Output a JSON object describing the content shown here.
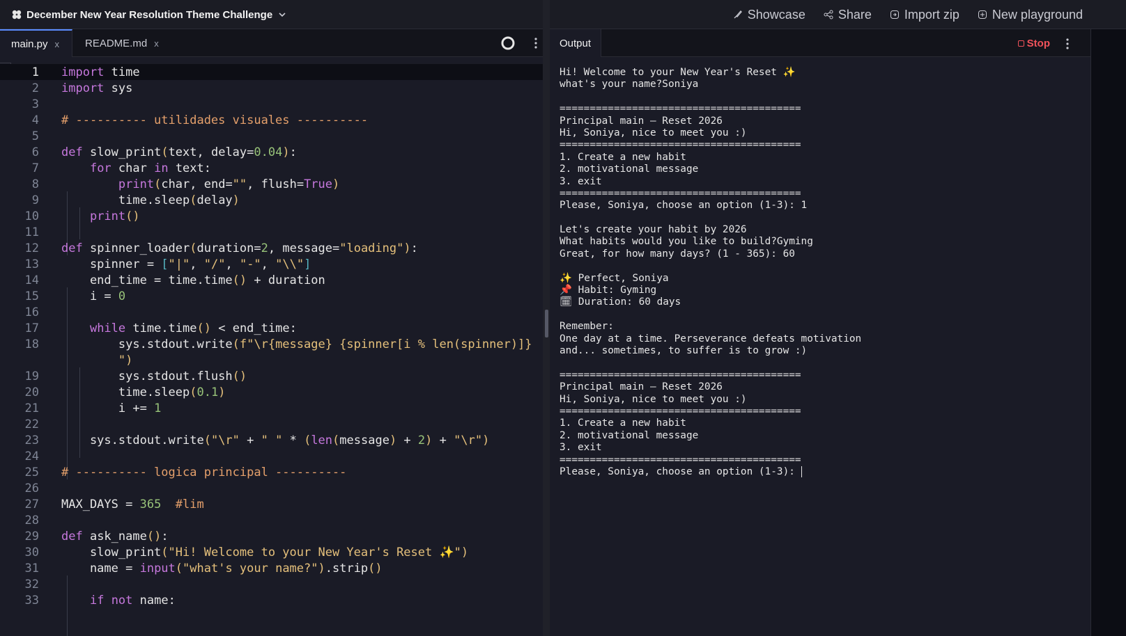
{
  "topbar": {
    "title": "December New Year Resolution Theme Challenge",
    "actions": [
      {
        "label": "Showcase",
        "icon": "brush-icon"
      },
      {
        "label": "Share",
        "icon": "share-icon"
      },
      {
        "label": "Import zip",
        "icon": "import-icon"
      },
      {
        "label": "New playground",
        "icon": "plus-circle-icon"
      }
    ]
  },
  "editor": {
    "tabs": [
      {
        "label": "main.py",
        "active": true
      },
      {
        "label": "README.md",
        "active": false
      }
    ],
    "close_glyph": "x"
  },
  "output": {
    "tab_label": "Output",
    "stop_label": "Stop",
    "lines": [
      "Hi! Welcome to your New Year's Reset ✨",
      "what's your name?Soniya",
      "",
      "========================================",
      "Principal main — Reset 2026",
      "Hi, Soniya, nice to meet you :)",
      "========================================",
      "1. Create a new habit",
      "2. motivational message",
      "3. exit",
      "========================================",
      "Please, Soniya, choose an option (1-3): 1",
      "",
      "Let's create your habit by 2026",
      "What habits would you like to build?Gyming",
      "Great, for how many days? (1 - 365): 60",
      "",
      "✨ Perfect, Soniya",
      "📌 Habit: Gyming",
      "🗓 Duration: 60 days",
      "",
      "Remember:",
      "One day at a time. Perseverance defeats motivation",
      "and... sometimes, to suffer is to grow :)",
      "",
      "========================================",
      "Principal main — Reset 2026",
      "Hi, Soniya, nice to meet you :)",
      "========================================",
      "1. Create a new habit",
      "2. motivational message",
      "3. exit",
      "========================================",
      "Please, Soniya, choose an option (1-3): "
    ]
  },
  "code": {
    "line_numbers": [
      "1",
      "2",
      "3",
      "4",
      "5",
      "6",
      "7",
      "8",
      "9",
      "10",
      "11",
      "12",
      "13",
      "14",
      "15",
      "16",
      "17",
      "18",
      "19",
      "20",
      "21",
      "22",
      "23",
      "24",
      "25",
      "26",
      "27",
      "28",
      "29",
      "30",
      "31",
      "32",
      "33"
    ],
    "lines": [
      "import time",
      "import sys",
      "",
      "# ---------- utilidades visuales ----------",
      "",
      "def slow_print(text, delay=0.04):",
      "    for char in text:",
      "        print(char, end=\"\", flush=True)",
      "        time.sleep(delay)",
      "    print()",
      "",
      "def spinner_loader(duration=2, message=\"loading\"):",
      "    spinner = [\"|\", \"/\", \"-\", \"\\\\\"]",
      "    end_time = time.time() + duration",
      "    i = 0",
      "",
      "    while time.time() < end_time:",
      "        sys.stdout.write(f\"\\r{message} {spinner[i % len(spinner)]}",
      "        \")",
      "        sys.stdout.flush()",
      "        time.sleep(0.1)",
      "        i += 1",
      "",
      "    sys.stdout.write(\"\\r\" + \" \" * (len(message) + 2) + \"\\r\")",
      "",
      "# ---------- logica principal ----------",
      "",
      "MAX_DAYS = 365  #lim",
      "",
      "def ask_name():",
      "    slow_print(\"Hi! Welcome to your New Year's Reset ✨\")",
      "    name = input(\"what's your name?\").strip()",
      "",
      "    if not name:"
    ]
  }
}
